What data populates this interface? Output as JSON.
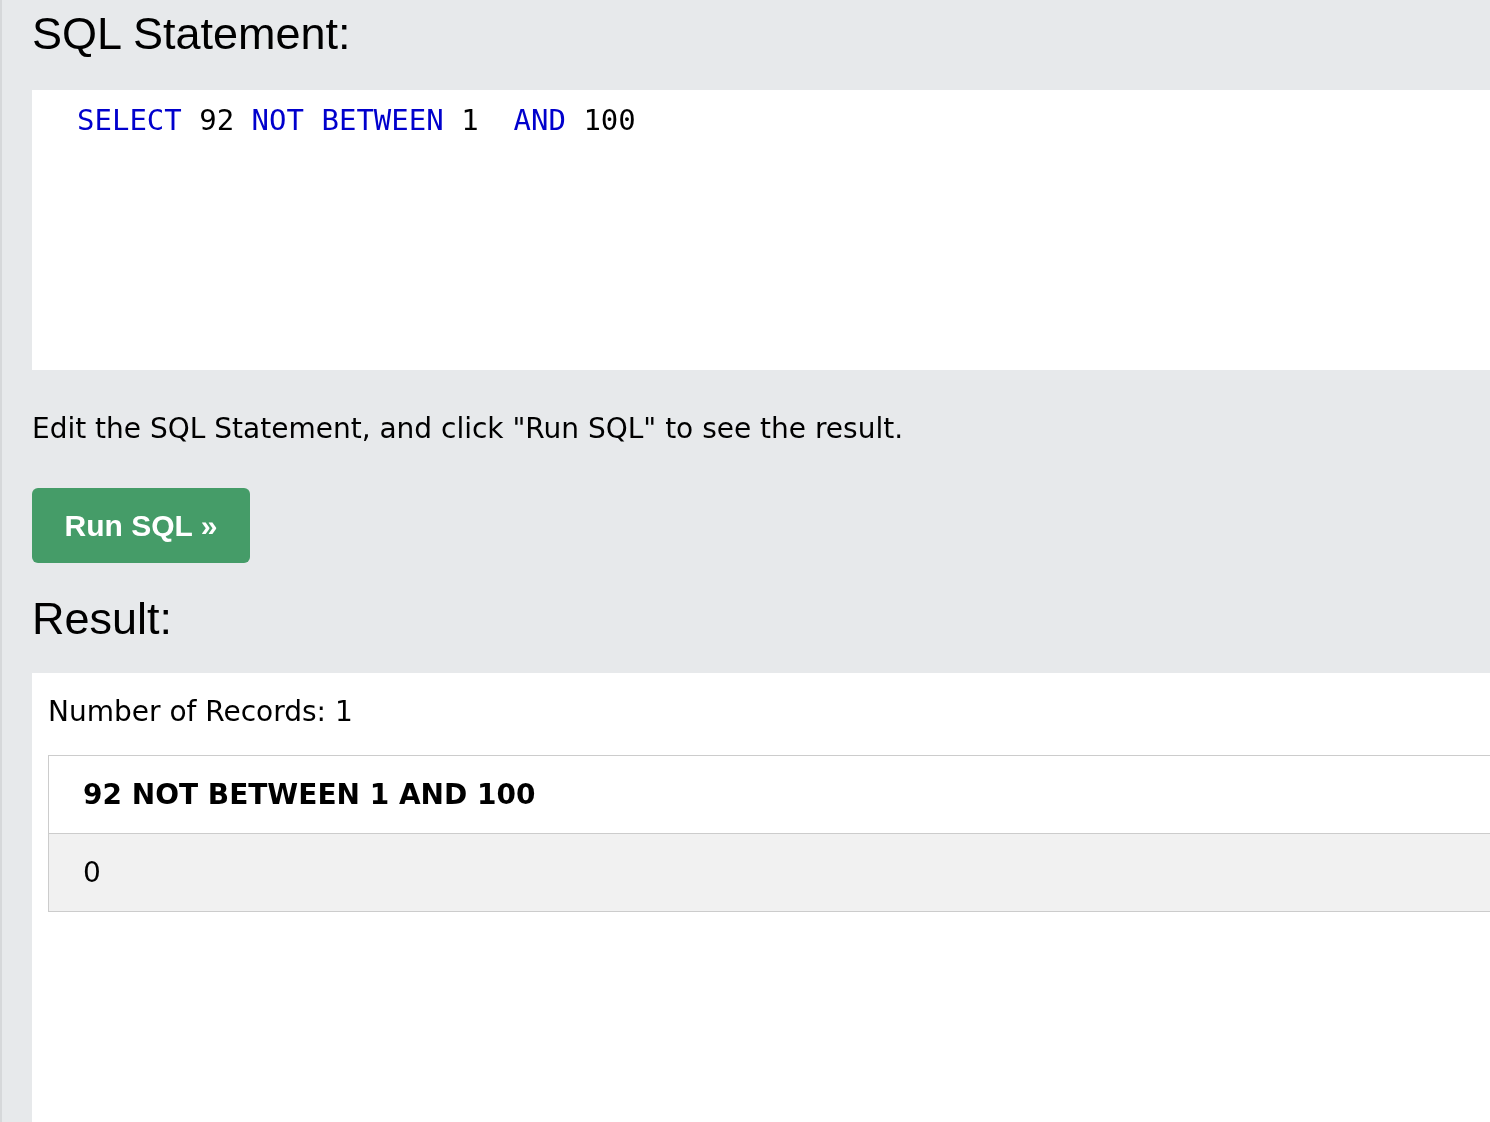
{
  "statement_heading": "SQL Statement:",
  "code_tokens": [
    {
      "text": "SELECT",
      "kind": "keyword"
    },
    {
      "text": " 92 ",
      "kind": "plain"
    },
    {
      "text": "NOT",
      "kind": "keyword"
    },
    {
      "text": " BETWEEN",
      "kind": "keyword"
    },
    {
      "text": " 1  ",
      "kind": "plain"
    },
    {
      "text": "AND",
      "kind": "keyword"
    },
    {
      "text": " 100",
      "kind": "plain"
    }
  ],
  "instruction": "Edit the SQL Statement, and click \"Run SQL\" to see the result.",
  "run_button": "Run SQL »",
  "result_heading": "Result:",
  "record_count": "Number of Records: 1",
  "table": {
    "columns": [
      "92 NOT BETWEEN 1 AND 100"
    ],
    "rows": [
      [
        "0"
      ]
    ]
  }
}
